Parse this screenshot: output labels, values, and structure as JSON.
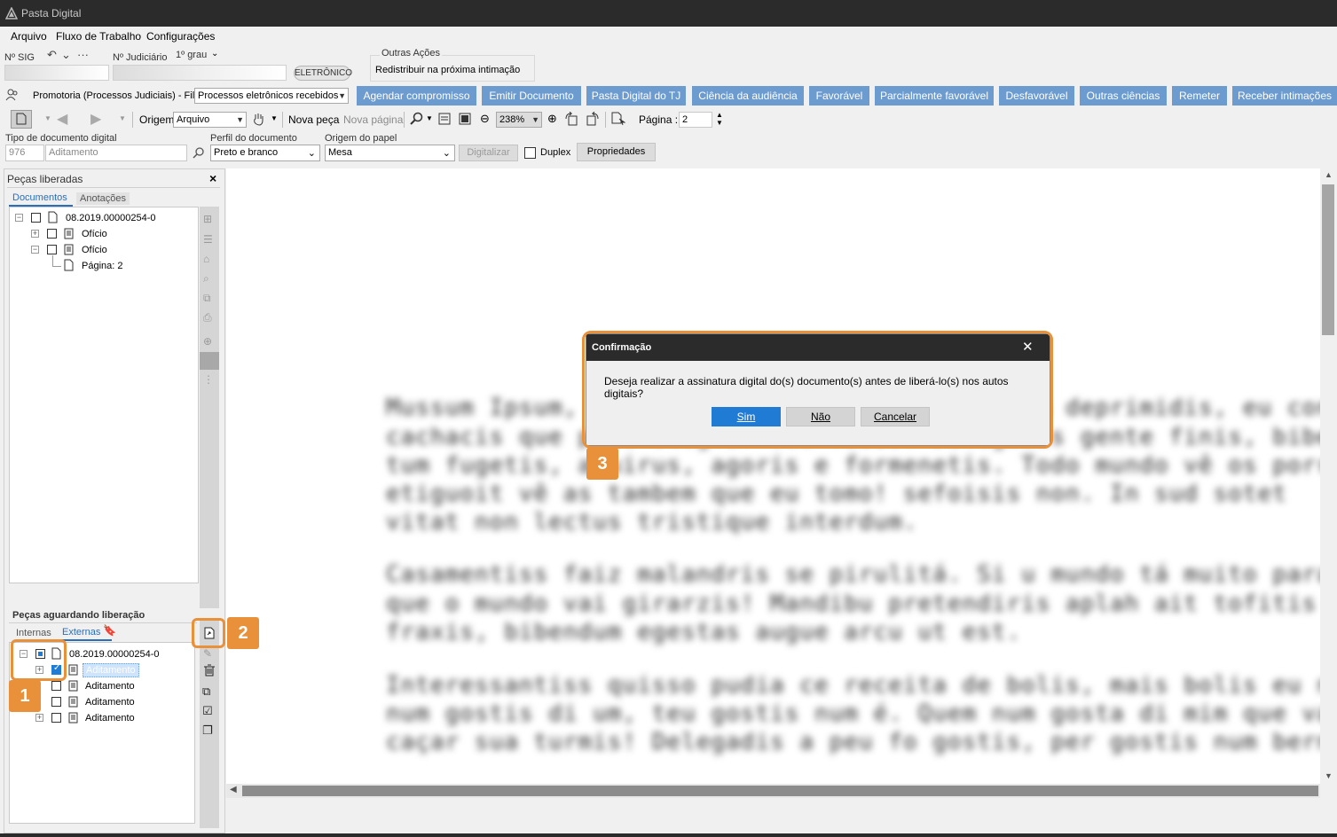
{
  "app": {
    "title": "Pasta Digital"
  },
  "menu": [
    "Arquivo",
    "Fluxo de Trabalho",
    "Configurações"
  ],
  "header": {
    "sig_label": "Nº SIG",
    "sig_icons": [
      "↶",
      "⌄",
      "···"
    ],
    "judiciario_label": "Nº Judiciário",
    "grau_value": "1º grau",
    "eletronico_badge": "ELETRÔNICO",
    "outras_acoes_label": "Outras Ações",
    "outras_acoes_item": "Redistribuir na próxima intimação"
  },
  "fila": {
    "label": "Promotoria (Processos Judiciais) - Fila",
    "value": "Processos eletrônicos recebidos"
  },
  "action_buttons": [
    "Agendar compromisso",
    "Emitir Documento",
    "Pasta Digital do TJ",
    "Ciência da audiência",
    "Favorável",
    "Parcialmente favorável",
    "Desfavorável",
    "Outras ciências",
    "Remeter",
    "Receber intimações"
  ],
  "toolbar": {
    "origem_label": "Origem",
    "origem_value": "Arquivo",
    "nova_peca": "Nova peça",
    "nova_pagina": "Nova página",
    "zoom_value": "238%",
    "pagina_label": "Página :",
    "pagina_value": "2"
  },
  "docform": {
    "tipo_label": "Tipo de documento digital",
    "tipo_code": "976",
    "tipo_name": "Aditamento",
    "perfil_label": "Perfil do documento",
    "perfil_value": "Preto e branco",
    "origem_papel_label": "Origem do papel",
    "origem_papel_value": "Mesa",
    "digitalizar": "Digitalizar",
    "duplex": "Duplex",
    "propriedades": "Propriedades"
  },
  "pecas_liberadas": {
    "title": "Peças liberadas",
    "close": "×",
    "tabs": [
      "Documentos",
      "Anotações"
    ],
    "tree": [
      {
        "label": "08.2019.00000254-0"
      },
      {
        "label": "Ofício"
      },
      {
        "label": "Ofício"
      },
      {
        "label": "Página: 2"
      }
    ]
  },
  "pecas_aguardando": {
    "title": "Peças aguardando liberação",
    "tabs": [
      "Internas",
      "Externas"
    ],
    "tree": [
      {
        "label": "08.2019.00000254-0"
      },
      {
        "label": "Aditamento"
      },
      {
        "label": "Aditamento"
      },
      {
        "label": "Aditamento"
      },
      {
        "label": "Aditamento"
      }
    ]
  },
  "document_preview": {
    "lines": [
      "Mussum Ipsum, cacilds vidis litro abertis. Tá deprimidis, eu conheço uma",
      "cachacis que pode alegrar sua vidis. Delegadis gente finis, bibendum",
      "tum fugetis, atuirus, agoris e formenetis. Todo mundo vê os porris",
      "etiguoit vê as tambem que eu tomo! sefoisis non. In sud sotet",
      "vitat non lectus tristique interdum.",
      "Casamentiss faiz malandris se pirulitá. Si u mundo tá muito paradis?",
      "que o mundo vai girarzis! Mandibu pretendiris aplah ait tofitis",
      "fraxis, bibendum egestas augue arcu ut est.",
      "Interessantiss quisso pudia ce receita de bolis, mais bolis eu num",
      "num gostis di um, teu gostis num é. Quem num gosta di mim que vai",
      "caçar sua turmis! Delegadis a peu fo gostis, per gostis num bernum."
    ]
  },
  "dialog": {
    "title": "Confirmação",
    "close": "✕",
    "message": "Deseja realizar a assinatura digital do(s) documento(s) antes de liberá-lo(s) nos autos digitais?",
    "yes": "Sim",
    "no": "Não",
    "cancel": "Cancelar"
  },
  "callouts": [
    "1",
    "2",
    "3"
  ],
  "colors": {
    "accent": "#6c9bd0",
    "callout": "#e8913a",
    "primary_button": "#1f7bd4",
    "titlebar": "#2b2b2b"
  }
}
